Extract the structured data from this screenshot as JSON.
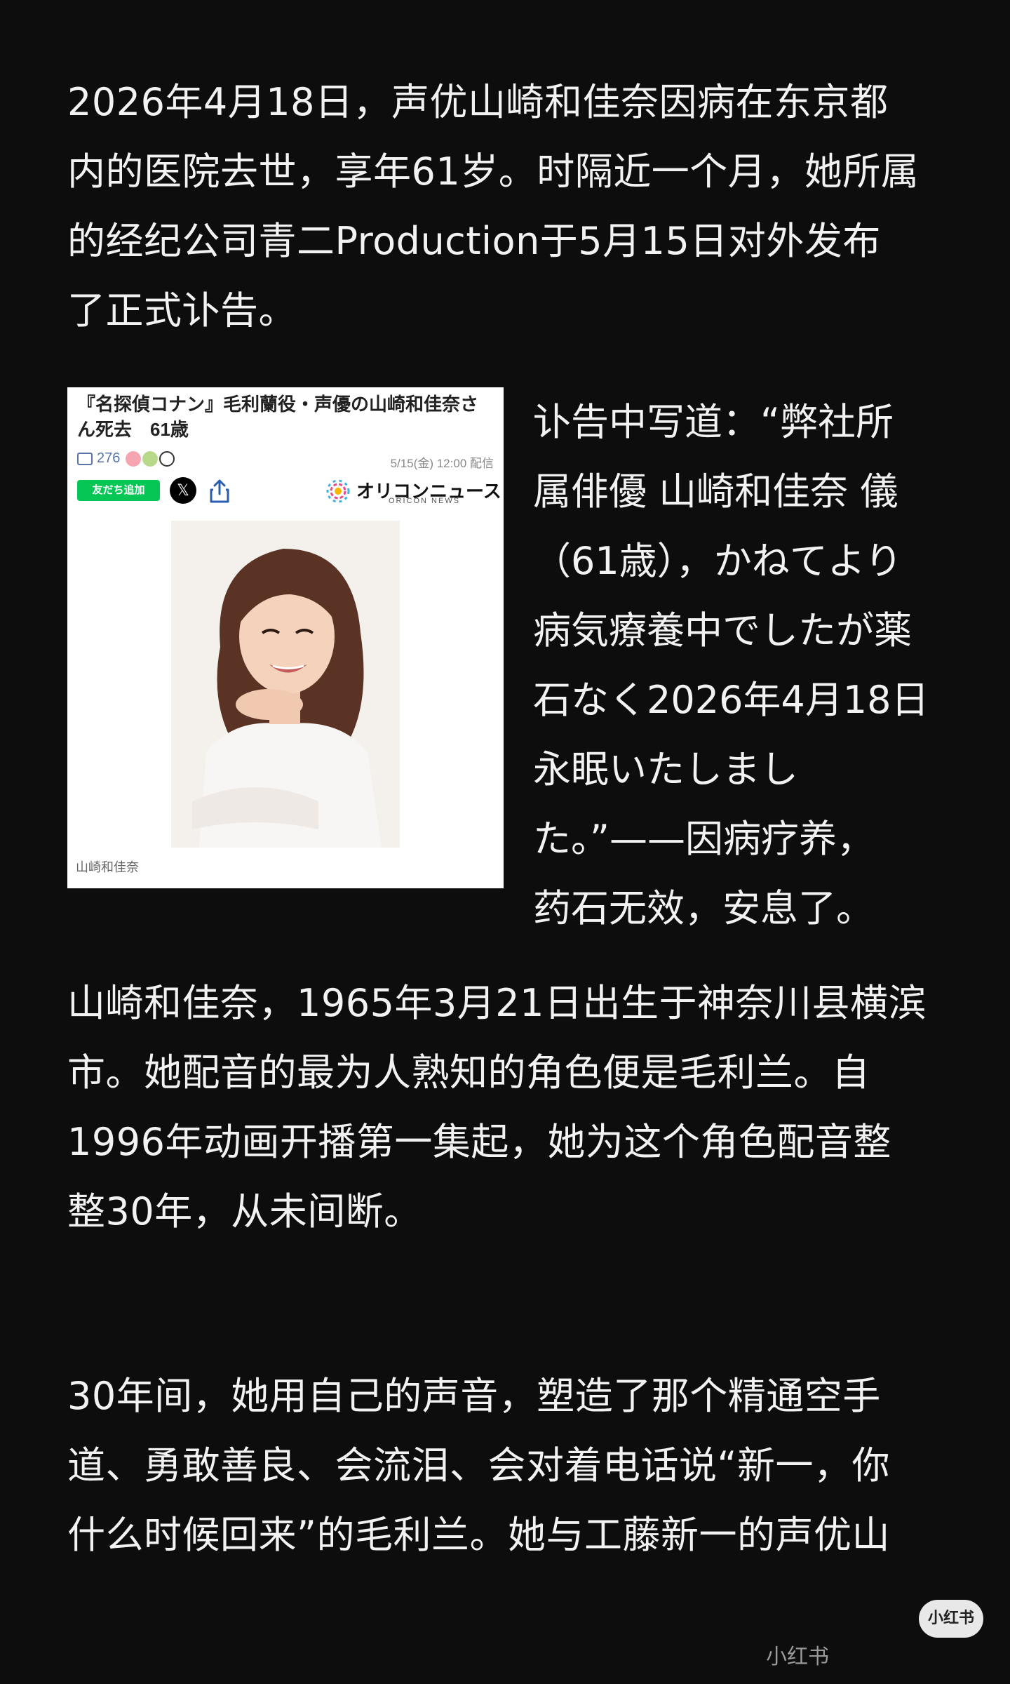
{
  "article": {
    "paragraph1": "2026年4月18日，声优山崎和佳奈因病在东京都\n内的医院去世，享年61岁。时隔近一个月，她所属\n的经纪公司青二Production于5月15日对外发布\n了正式讣告。",
    "side_text": "讣告中写道：“弊社所\n属俳優 山崎和佳奈 儀\n（61歳），かねてより\n病気療養中でしたが薬\n石なく2026年4月18日\n永眠いたしまし\nた。”——因病疗养，\n药石无效，安息了。",
    "paragraph3": "山崎和佳奈，1965年3月21日出生于神奈川县横滨\n市。她配音的最为人熟知的角色便是毛利兰。自\n1996年动画开播第一集起，她为这个角色配音整\n整30年，从未间断。",
    "paragraph4": "30年间，她用自己的声音，塑造了那个精通空手\n道、勇敢善良、会流泪、会对着电话说“新一，你\n什么时候回来”的毛利兰。她与工藤新一的声优山"
  },
  "news_card": {
    "title": "『名探偵コナン』毛利蘭役・声優の山崎和佳奈さん死去　61歳",
    "comment_count": "276",
    "date": "5/15(金) 12:00 配信",
    "line_button": "友だち追加",
    "x_button": "𝕏",
    "brand_name": "オリコンニュース",
    "brand_sub": "ORICON NEWS",
    "caption": "山崎和佳奈"
  },
  "footer": {
    "logo_badge": "小红书",
    "watermark": "小红书"
  },
  "colors": {
    "background": "#0d0d0d",
    "text": "#f2f2f2",
    "line_green": "#06c755"
  }
}
